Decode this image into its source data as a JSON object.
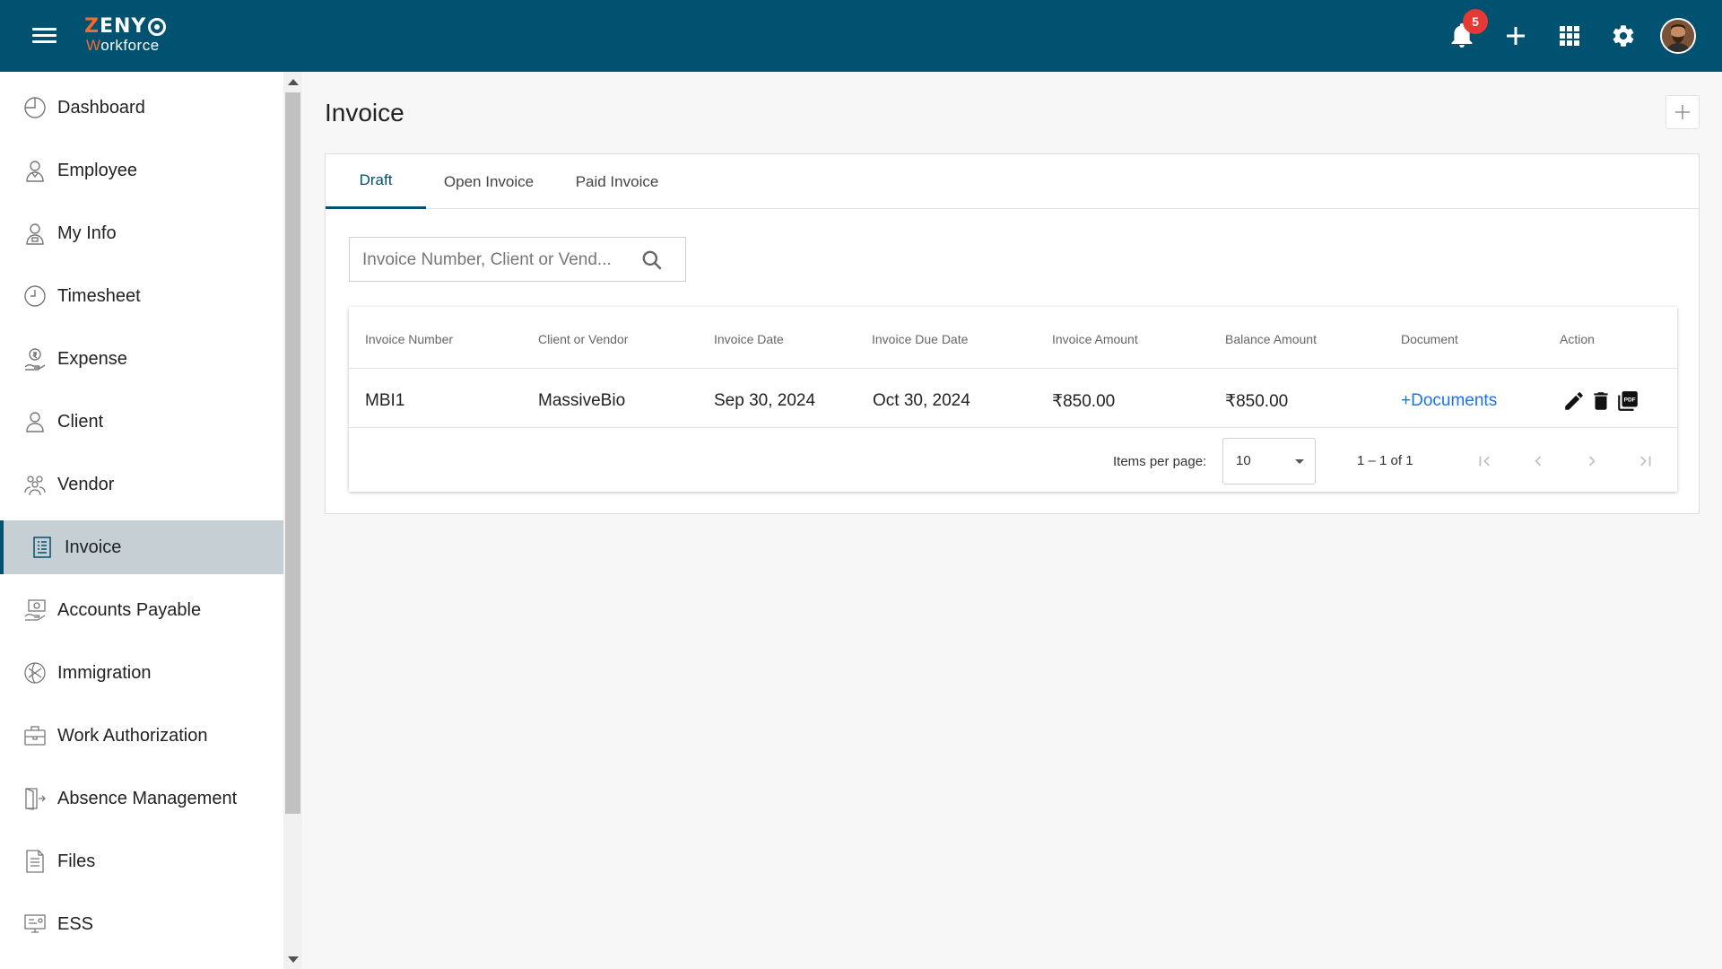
{
  "header": {
    "logo_line1_z": "Z",
    "logo_line1_rest": "ENY",
    "logo_line2_w": "W",
    "logo_line2_rest": "orkforce",
    "notifications_count": "5",
    "brand_color": "#015171",
    "icons": [
      "menu-icon",
      "bell-icon",
      "plus-icon",
      "apps-grid-icon",
      "gear-icon",
      "avatar"
    ]
  },
  "sidebar": {
    "items": [
      {
        "label": "Dashboard",
        "icon": "dashboard-icon"
      },
      {
        "label": "Employee",
        "icon": "employee-icon"
      },
      {
        "label": "My Info",
        "icon": "my-info-icon"
      },
      {
        "label": "Timesheet",
        "icon": "clock-icon"
      },
      {
        "label": "Expense",
        "icon": "expense-icon"
      },
      {
        "label": "Client",
        "icon": "person-icon"
      },
      {
        "label": "Vendor",
        "icon": "vendor-icon"
      },
      {
        "label": "Invoice",
        "icon": "invoice-icon",
        "active": true
      },
      {
        "label": "Accounts Payable",
        "icon": "accounts-payable-icon"
      },
      {
        "label": "Immigration",
        "icon": "globe-icon"
      },
      {
        "label": "Work Authorization",
        "icon": "briefcase-icon"
      },
      {
        "label": "Absence Management",
        "icon": "exit-door-icon"
      },
      {
        "label": "Files",
        "icon": "file-icon"
      },
      {
        "label": "ESS",
        "icon": "ess-icon"
      }
    ]
  },
  "main": {
    "title": "Invoice",
    "tabs": [
      {
        "label": "Draft",
        "active": true
      },
      {
        "label": "Open Invoice"
      },
      {
        "label": "Paid Invoice"
      }
    ],
    "search": {
      "placeholder": "Invoice Number, Client or Vend...",
      "value": ""
    },
    "table": {
      "columns": [
        "Invoice Number",
        "Client or Vendor",
        "Invoice Date",
        "Invoice Due Date",
        "Invoice Amount",
        "Balance Amount",
        "Document",
        "Action"
      ],
      "rows": [
        {
          "invoice_number": "MBI1",
          "client_or_vendor": "MassiveBio",
          "invoice_date": "Sep 30, 2024",
          "invoice_due_date": "Oct 30, 2024",
          "invoice_amount": "₹850.00",
          "balance_amount": "₹850.00",
          "document": "+Documents",
          "actions": [
            "edit-icon",
            "delete-icon",
            "pdf-icon"
          ]
        }
      ]
    },
    "paginator": {
      "items_per_page_label": "Items per page:",
      "items_per_page": "10",
      "range": "1 – 1 of 1"
    }
  }
}
